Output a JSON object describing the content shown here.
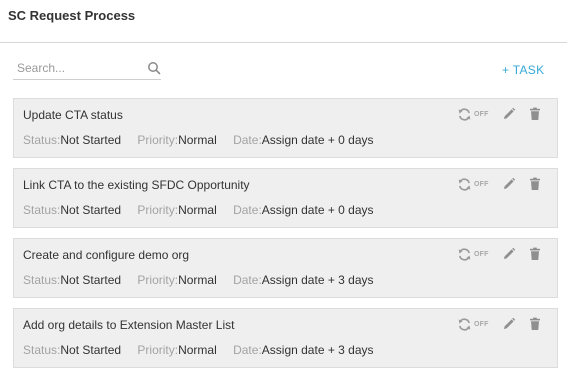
{
  "header": {
    "title": "SC Request Process"
  },
  "search": {
    "placeholder": "Search...",
    "value": "",
    "icon": "search-icon"
  },
  "add_task_label": "+ TASK",
  "labels": {
    "status": "Status:",
    "priority": "Priority:",
    "date": "Date:",
    "sync_off": "OFF"
  },
  "colors": {
    "accent": "#36a9d6",
    "card_bg": "#efefef",
    "muted_text": "#a3a3a3"
  },
  "tasks": [
    {
      "name": "Update CTA status",
      "status": "Not Started",
      "priority": "Normal",
      "date": "Assign date + 0 days"
    },
    {
      "name": "Link CTA to the existing SFDC Opportunity",
      "status": "Not Started",
      "priority": "Normal",
      "date": "Assign date + 0 days"
    },
    {
      "name": "Create and configure demo org",
      "status": "Not Started",
      "priority": "Normal",
      "date": "Assign date + 3 days"
    },
    {
      "name": "Add org details to Extension Master List",
      "status": "Not Started",
      "priority": "Normal",
      "date": "Assign date + 3 days"
    }
  ]
}
